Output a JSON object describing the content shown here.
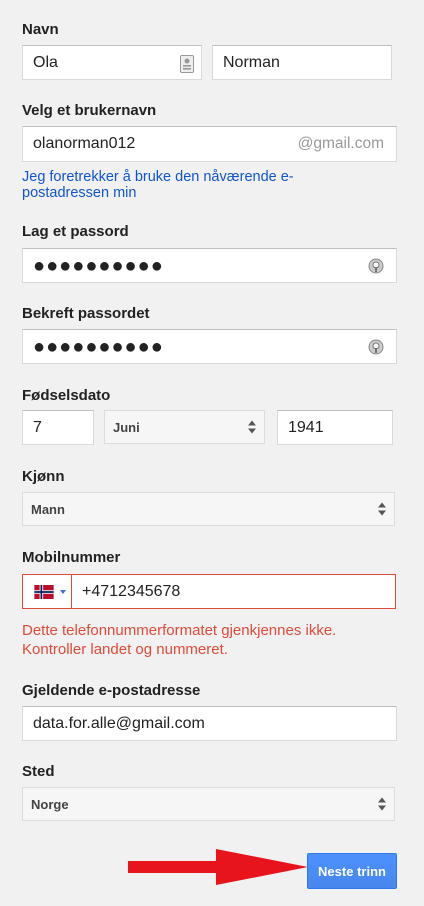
{
  "name": {
    "label": "Navn",
    "first": "Ola",
    "last": "Norman"
  },
  "username": {
    "label": "Velg et brukernavn",
    "value": "olanorman012",
    "suffix": "@gmail.com",
    "alt_link": "Jeg foretrekker å bruke den nåværende e-postadressen min"
  },
  "password": {
    "label": "Lag et passord",
    "masked": "●●●●●●●●●●"
  },
  "confirm_password": {
    "label": "Bekreft passordet",
    "masked": "●●●●●●●●●●"
  },
  "birthdate": {
    "label": "Fødselsdato",
    "day": "7",
    "month": "Juni",
    "year": "1941"
  },
  "gender": {
    "label": "Kjønn",
    "value": "Mann"
  },
  "mobile": {
    "label": "Mobilnummer",
    "value": "+4712345678",
    "country_flag": "norway-flag-icon",
    "error": "Dette telefonnummerformatet gjenkjennes ikke. Kontroller landet og nummeret."
  },
  "current_email": {
    "label": "Gjeldende e-postadresse",
    "value": "data.for.alle@gmail.com"
  },
  "location": {
    "label": "Sted",
    "value": "Norge"
  },
  "next_button": "Neste trinn",
  "colors": {
    "accent": "#4d90fe",
    "error": "#dd4b39",
    "link": "#1155cc",
    "arrow": "#e8141b"
  }
}
